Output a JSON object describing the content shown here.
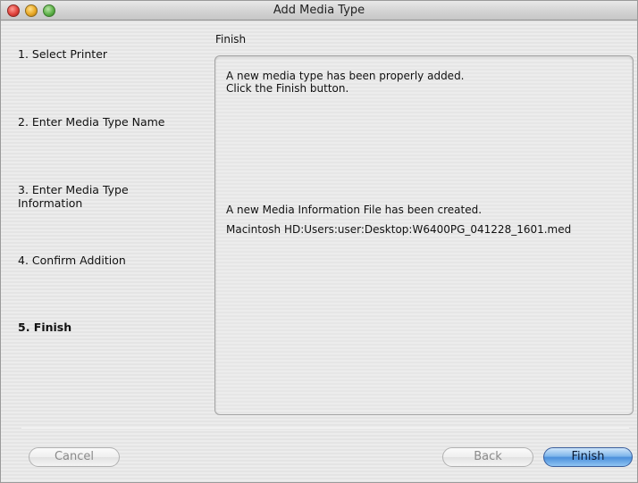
{
  "window": {
    "title": "Add Media Type"
  },
  "steps": [
    {
      "label": "1. Select Printer",
      "active": false
    },
    {
      "label": "2. Enter Media Type Name",
      "active": false
    },
    {
      "label": "3. Enter Media Type Information",
      "active": false
    },
    {
      "label": "4. Confirm Addition",
      "active": false
    },
    {
      "label": "5. Finish",
      "active": true
    }
  ],
  "section": {
    "title": "Finish"
  },
  "panel": {
    "line1": "A new media type has been properly added.",
    "line2": "Click the Finish button.",
    "line3": "A new Media Information File has been created.",
    "line4": "Macintosh HD:Users:user:Desktop:W6400PG_041228_1601.med"
  },
  "buttons": {
    "cancel": "Cancel",
    "back": "Back",
    "finish": "Finish"
  }
}
